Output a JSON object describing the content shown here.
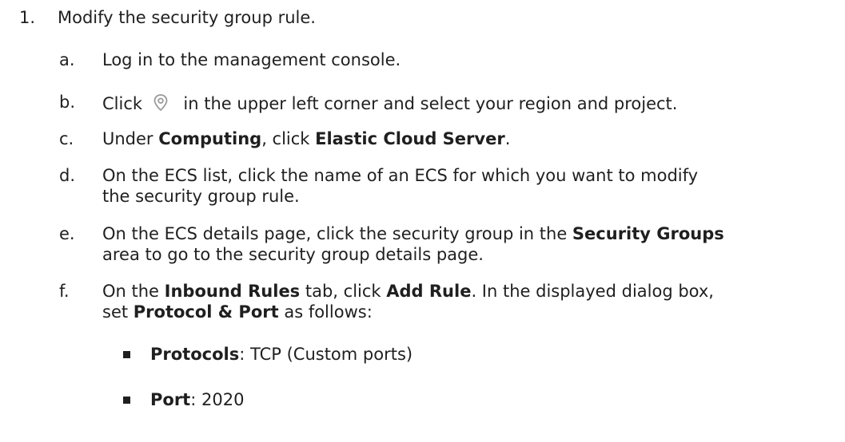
{
  "step1": {
    "number": "1.",
    "text": "Modify the security group rule."
  },
  "substeps": {
    "a": {
      "letter": "a.",
      "text": "Log in to the management console."
    },
    "b": {
      "letter": "b.",
      "before": "Click",
      "icon": "location-pin-icon",
      "after": "in the upper left corner and select your region and project."
    },
    "c": {
      "letter": "c.",
      "t1": "Under ",
      "b1": "Computing",
      "t2": ", click ",
      "b2": "Elastic Cloud Server",
      "t3": "."
    },
    "d": {
      "letter": "d.",
      "line1": "On the ECS list, click the name of an ECS for which you want to modify",
      "line2": "the security group rule."
    },
    "e": {
      "letter": "e.",
      "t1": "On the ECS details page, click the security group in the ",
      "b1": "Security Groups",
      "line2": "area to go to the security group details page."
    },
    "f": {
      "letter": "f.",
      "t1": "On the ",
      "b1": "Inbound Rules",
      "t2": " tab, click ",
      "b2": "Add Rule",
      "t3": ". In the displayed dialog box,",
      "l2t1": "set ",
      "l2b1": "Protocol & Port",
      "l2t2": " as follows:"
    }
  },
  "bullets": [
    {
      "label": "Protocols",
      "sep": ": ",
      "value": "TCP (Custom ports)"
    },
    {
      "label": "Port",
      "sep": ": ",
      "value": "2020"
    }
  ],
  "colors": {
    "text": "#1f1f1f",
    "icon": "#9a9a9a"
  }
}
